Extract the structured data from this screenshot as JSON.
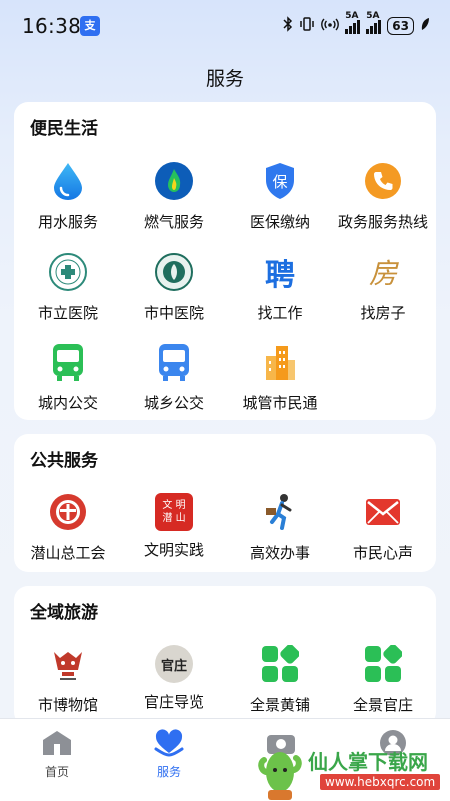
{
  "status_bar": {
    "time": "16:38",
    "app_badge": "支",
    "battery": "63",
    "signal1_label": "5A",
    "signal2_label": "5A"
  },
  "page": {
    "title": "服务"
  },
  "sections": [
    {
      "title": "便民生活",
      "items": [
        {
          "label": "用水服务",
          "icon": "water-drop-icon"
        },
        {
          "label": "燃气服务",
          "icon": "gas-flame-icon"
        },
        {
          "label": "医保缴纳",
          "icon": "shield-icon"
        },
        {
          "label": "政务服务热线",
          "icon": "phone-icon"
        },
        {
          "label": "市立医院",
          "icon": "hospital-logo-icon"
        },
        {
          "label": "市中医院",
          "icon": "hospital-logo-icon"
        },
        {
          "label": "找工作",
          "icon": "job-icon",
          "glyph": "聘"
        },
        {
          "label": "找房子",
          "icon": "house-icon",
          "glyph": "房"
        },
        {
          "label": "城内公交",
          "icon": "bus-icon"
        },
        {
          "label": "城乡公交",
          "icon": "bus-icon"
        },
        {
          "label": "城管市民通",
          "icon": "building-icon"
        }
      ]
    },
    {
      "title": "公共服务",
      "items": [
        {
          "label": "潜山总工会",
          "icon": "union-logo-icon"
        },
        {
          "label": "文明实践",
          "icon": "civilization-seal-icon",
          "glyph": "文 明 潜 山"
        },
        {
          "label": "高效办事",
          "icon": "running-man-icon"
        },
        {
          "label": "市民心声",
          "icon": "mail-icon"
        }
      ]
    },
    {
      "title": "全域旅游",
      "items": [
        {
          "label": "市博物馆",
          "icon": "museum-logo-icon"
        },
        {
          "label": "官庄导览",
          "icon": "guanzhuang-logo-icon",
          "glyph": "官庄"
        },
        {
          "label": "全景黄铺",
          "icon": "grid-apps-icon"
        },
        {
          "label": "全景官庄",
          "icon": "grid-apps-icon"
        }
      ]
    }
  ],
  "bottom_nav": [
    {
      "label": "首页",
      "icon": "home-icon",
      "active": false
    },
    {
      "label": "服务",
      "icon": "service-heart-icon",
      "active": true
    },
    {
      "label": "",
      "icon": "camera-icon",
      "active": false
    },
    {
      "label": "",
      "icon": "profile-icon",
      "active": false
    }
  ],
  "colors": {
    "accent": "#2f6ff1",
    "green": "#2bbf56",
    "card": "#ffffff"
  },
  "watermark": {
    "text": "仙人掌下载网",
    "url": "www.hebxqrc.com"
  }
}
